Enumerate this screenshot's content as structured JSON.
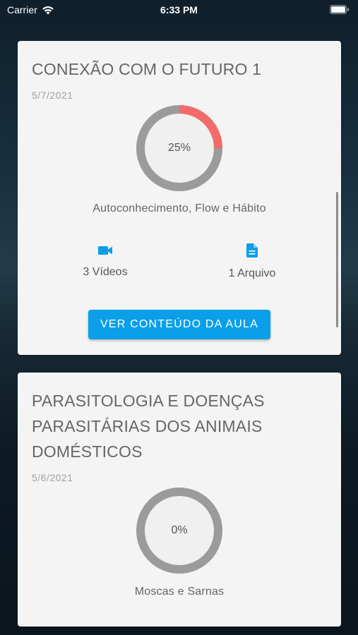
{
  "status_bar": {
    "carrier": "Carrier",
    "time": "6:33 PM",
    "icons": [
      "wifi-icon",
      "battery-icon"
    ]
  },
  "theme": {
    "card_background": "#f4f4f4",
    "accent": "#0a9fe8",
    "progress_fill": "#f26b6b",
    "progress_track": "#9b9b9b"
  },
  "lessons": [
    {
      "title": "CONEXÃO COM O FUTURO 1",
      "date": "5/7/2021",
      "progress_percent": 25,
      "progress_label": "25%",
      "subject": "Autoconhecimento, Flow e Hábito",
      "videos_label": "3 Vídeos",
      "files_label": "1 Arquivo",
      "button_label": "VER CONTEÚDO DA AULA",
      "icons": [
        "video-camera-icon",
        "document-icon"
      ]
    },
    {
      "title_lines": [
        "PARASITOLOGIA E DOENÇAS",
        "PARASITÁRIAS DOS ANIMAIS",
        "DOMÉSTICOS"
      ],
      "date": "5/6/2021",
      "progress_percent": 0,
      "progress_label": "0%",
      "subject": "Moscas e Sarnas"
    }
  ]
}
